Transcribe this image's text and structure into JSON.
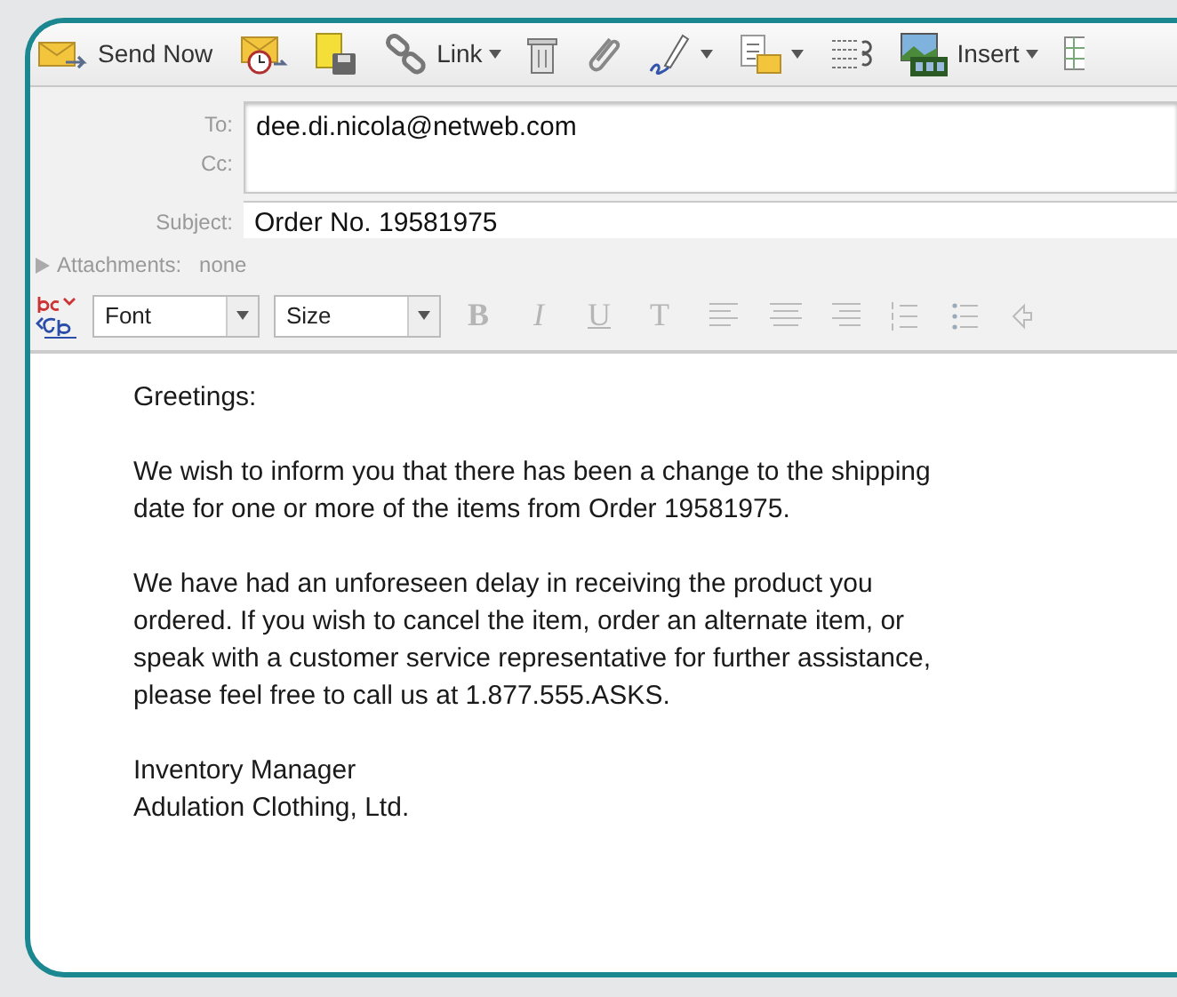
{
  "toolbar": [
    {
      "label": "Send Now",
      "dropdown": false
    },
    {
      "dropdown": false
    },
    {
      "dropdown": false
    },
    {
      "label": "Link",
      "dropdown": true
    },
    {
      "dropdown": false
    },
    {
      "dropdown": false
    },
    {
      "dropdown": true
    },
    {
      "dropdown": true
    },
    {
      "dropdown": false
    },
    {
      "label": "Insert",
      "dropdown": true
    },
    {
      "dropdown": false
    }
  ],
  "header": {
    "to_label": "To:",
    "to": "dee.di.nicola@netweb.com",
    "cc_label": "Cc:",
    "subject_label": "Subject:",
    "subject": "Order No. 19581975",
    "attachments_label": "Attachments:",
    "attachments": "none",
    "attachments_expanded": false
  },
  "format_bar": {
    "font": "Font",
    "size": "Size",
    "styles": [
      {
        "label": "B",
        "kind": "bold",
        "disabled": true
      },
      {
        "label": "I",
        "kind": "italic",
        "disabled": true
      },
      {
        "label": "U",
        "kind": "underline",
        "disabled": true
      },
      {
        "label": "T",
        "kind": "plain",
        "disabled": true
      }
    ]
  },
  "body": [
    {
      "lines": [
        "Greetings:"
      ]
    },
    {
      "lines": [
        "We wish to inform you that there has been a change to the shipping",
        "date for one or more of the items from Order 19581975."
      ]
    },
    {
      "lines": [
        "We have had an unforeseen delay in receiving the product you",
        "ordered. If you wish to cancel the item, order an alternate item, or",
        "speak with a customer service representative for further assistance,",
        "please feel free to call us at 1.877.555.ASKS."
      ]
    },
    {
      "lines": [
        "Inventory Manager",
        "Adulation Clothing, Ltd."
      ]
    }
  ]
}
